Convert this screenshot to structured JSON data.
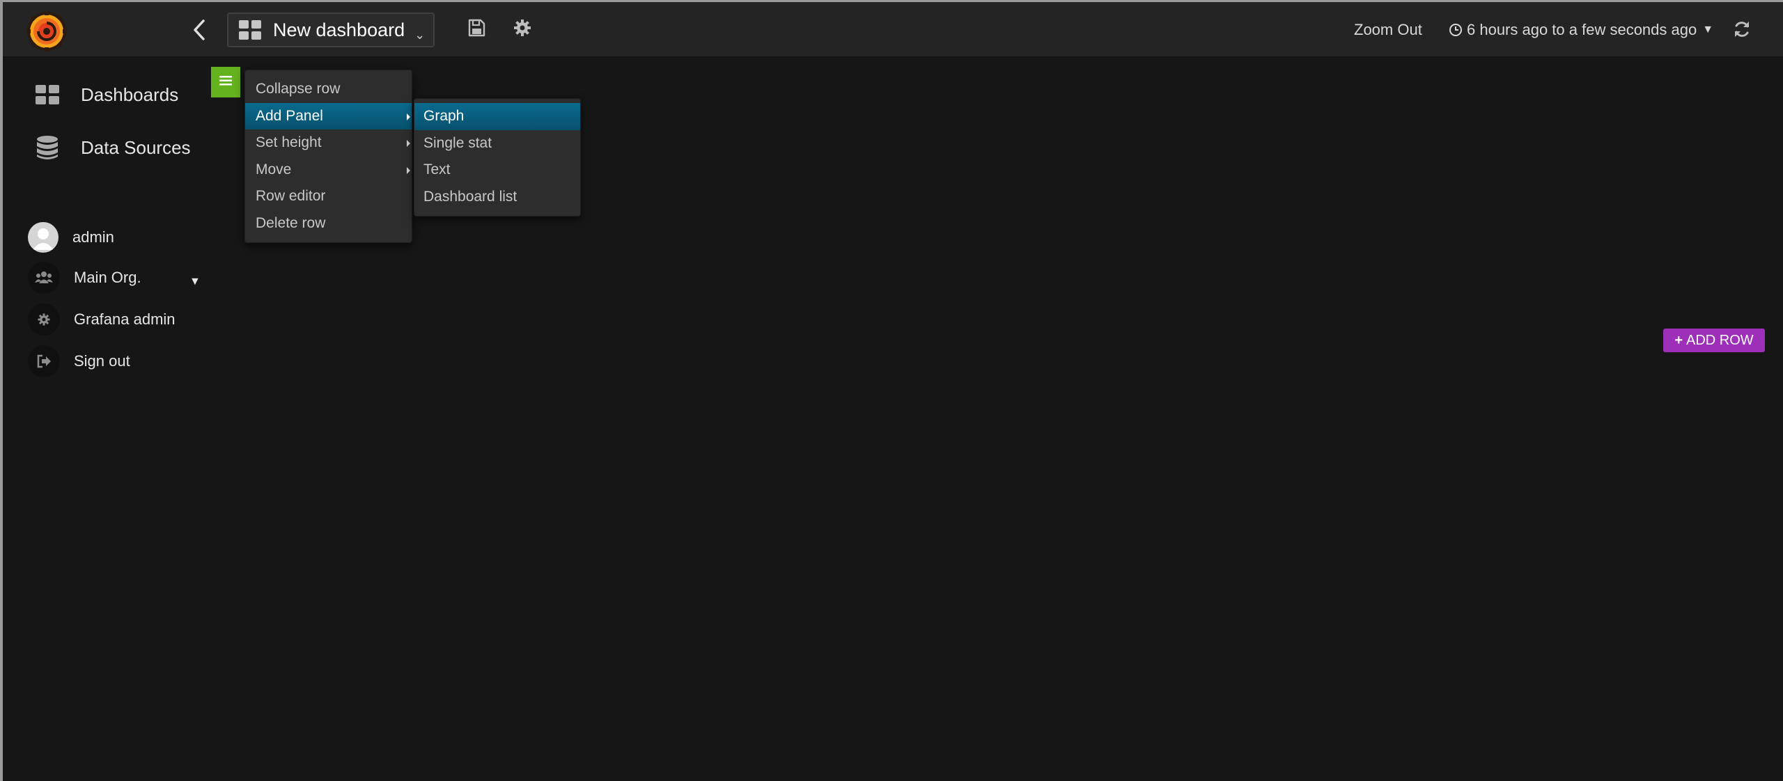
{
  "header": {
    "dashboard_title": "New dashboard",
    "zoom_out": "Zoom Out",
    "time_range": "6 hours ago to a few seconds ago"
  },
  "sidebar": {
    "main_items": [
      {
        "label": "Dashboards",
        "icon": "dashboards-grid-icon"
      },
      {
        "label": "Data Sources",
        "icon": "database-icon"
      }
    ],
    "user": {
      "name": "admin"
    },
    "org": {
      "label": "Main Org."
    },
    "admin_label": "Grafana admin",
    "signout_label": "Sign out"
  },
  "row_menu": {
    "items": [
      {
        "label": "Collapse row"
      },
      {
        "label": "Add Panel",
        "active": true
      },
      {
        "label": "Set height"
      },
      {
        "label": "Move"
      },
      {
        "label": "Row editor"
      },
      {
        "label": "Delete row"
      }
    ],
    "add_panel_submenu": [
      {
        "label": "Graph",
        "active": true
      },
      {
        "label": "Single stat"
      },
      {
        "label": "Text"
      },
      {
        "label": "Dashboard list"
      }
    ]
  },
  "add_row": {
    "label": "ADD ROW"
  },
  "colors": {
    "background": "#161616",
    "navbar": "#242424",
    "row_toggle": "#64b21d",
    "menu_active": "#0a6b8e",
    "add_row": "#9d2fb8"
  }
}
